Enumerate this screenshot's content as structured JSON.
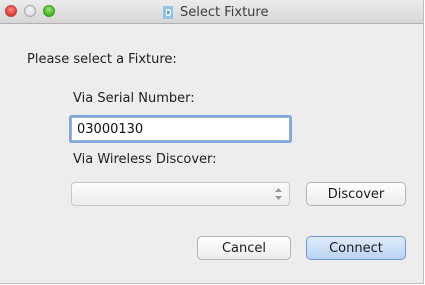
{
  "window": {
    "title": "Select Fixture",
    "accent_color": "#7ea6e0"
  },
  "form": {
    "prompt": "Please select a Fixture:",
    "serial_label": "Via Serial Number:",
    "serial_value": "03000130",
    "wireless_label": "Via Wireless Discover:",
    "wireless_selected": ""
  },
  "buttons": {
    "discover": "Discover",
    "cancel": "Cancel",
    "connect": "Connect"
  },
  "icons": {
    "app": "fixture-app-icon",
    "stepper": "up-down-stepper-icon"
  }
}
